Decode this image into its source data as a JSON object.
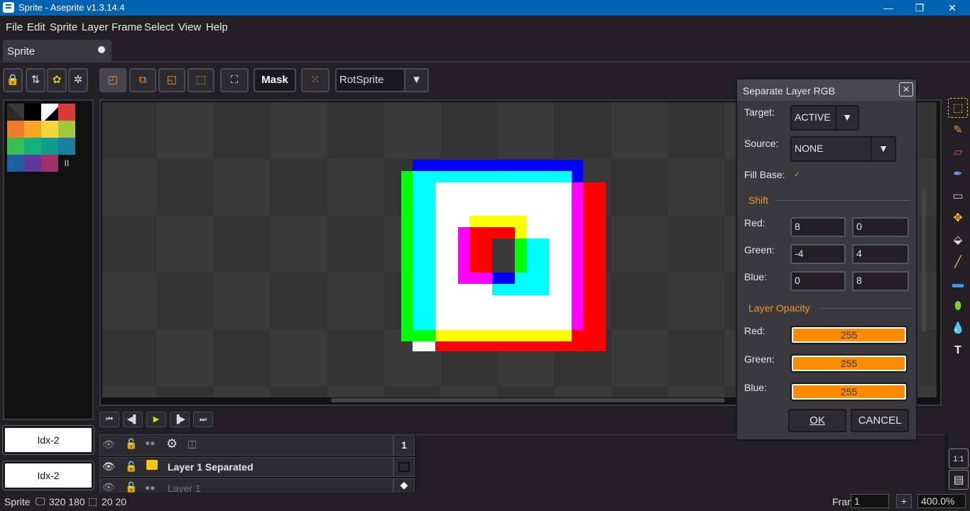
{
  "window": {
    "title": "Sprite - Aseprite v1.3.14.4",
    "min": "—",
    "max": "❐",
    "close": "✕"
  },
  "menu": [
    "File",
    "Edit",
    "Sprite",
    "Layer",
    "Frame",
    "Select",
    "View",
    "Help"
  ],
  "tab": {
    "label": "Sprite"
  },
  "toolbar": {
    "mask_label": "Mask",
    "rotation_algorithm": "RotSprite"
  },
  "palette": {
    "colors": [
      "#2a2a2a",
      "#000000",
      "#ffffff",
      "#d93a3a",
      "#f07b2a",
      "#f5a623",
      "#f5d63a",
      "#a0c93a",
      "#3abf4e",
      "#13b07a",
      "#0f9e8c",
      "#1a7fa0",
      "#1d5fa0",
      "#5a3a9a",
      "#a0306a",
      "#222222"
    ],
    "extra_label": "II"
  },
  "left_boxes": [
    "Idx-2",
    "Idx-2"
  ],
  "dialog": {
    "title": "Separate Layer RGB",
    "target_label": "Target:",
    "target_value": "ACTIVE",
    "source_label": "Source:",
    "source_value": "NONE",
    "fillbase_label": "Fill Base:",
    "shift_title": "Shift",
    "red_label": "Red:",
    "green_label": "Green:",
    "blue_label": "Blue:",
    "shift_red_x": "8",
    "shift_red_y": "0",
    "shift_green_x": "-4",
    "shift_green_y": "4",
    "shift_blue_x": "0",
    "shift_blue_y": "8",
    "opacity_title": "Layer Opacity",
    "opacity_red": "255",
    "opacity_green": "255",
    "opacity_blue": "255",
    "ok": "OK",
    "cancel": "CANCEL"
  },
  "timeline": {
    "frame_header": "1",
    "layers": [
      "Layer 1 Separated",
      "Layer 1"
    ]
  },
  "status": {
    "sprite": "Sprite",
    "size": "320 180",
    "grid": "20 20",
    "frame_label": "Frame:",
    "frame_value": "1",
    "plus": "+",
    "zoom": "400.0%"
  }
}
